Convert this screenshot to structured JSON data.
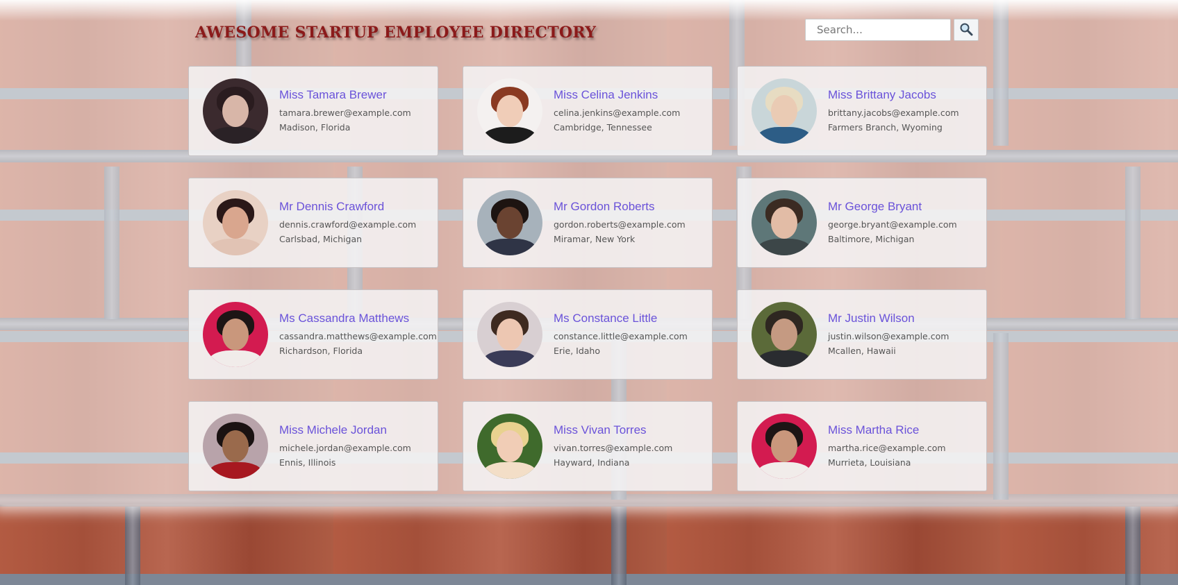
{
  "header": {
    "title": "AWESOME STARTUP EMPLOYEE DIRECTORY",
    "search_placeholder": "Search...",
    "search_icon": "magnifier-icon"
  },
  "employees": [
    {
      "name": "Miss Tamara Brewer",
      "email": "tamara.brewer@example.com",
      "location": "Madison, Florida",
      "avatar": {
        "bg": "#3b2a2e",
        "hair": "#2a1c1f",
        "face": "#d8b6a8",
        "body": "#2a2226"
      }
    },
    {
      "name": "Miss Celina Jenkins",
      "email": "celina.jenkins@example.com",
      "location": "Cambridge, Tennessee",
      "avatar": {
        "bg": "#f4f1f0",
        "hair": "#8a3a22",
        "face": "#f0cdb8",
        "body": "#1c1c1c"
      }
    },
    {
      "name": "Miss Brittany Jacobs",
      "email": "brittany.jacobs@example.com",
      "location": "Farmers Branch, Wyoming",
      "avatar": {
        "bg": "#c9d6d9",
        "hair": "#e7dcc2",
        "face": "#eacbb4",
        "body": "#2d5d86"
      }
    },
    {
      "name": "Mr Dennis Crawford",
      "email": "dennis.crawford@example.com",
      "location": "Carlsbad, Michigan",
      "avatar": {
        "bg": "#e8d1c4",
        "hair": "#2a1818",
        "face": "#d9a68e",
        "body": "#e1c3b4"
      }
    },
    {
      "name": "Mr Gordon Roberts",
      "email": "gordon.roberts@example.com",
      "location": "Miramar, New York",
      "avatar": {
        "bg": "#a7b2bb",
        "hair": "#1d1411",
        "face": "#6a4331",
        "body": "#2f3446"
      }
    },
    {
      "name": "Mr George Bryant",
      "email": "george.bryant@example.com",
      "location": "Baltimore, Michigan",
      "avatar": {
        "bg": "#5e7778",
        "hair": "#3b2b22",
        "face": "#e2bca6",
        "body": "#3c4648"
      }
    },
    {
      "name": "Ms Cassandra Matthews",
      "email": "cassandra.matthews@example.com",
      "location": "Richardson, Florida",
      "avatar": {
        "bg": "#d31b50",
        "hair": "#1d1515",
        "face": "#c9977c",
        "body": "#f1ecea"
      }
    },
    {
      "name": "Ms Constance Little",
      "email": "constance.little@example.com",
      "location": "Erie, Idaho",
      "avatar": {
        "bg": "#d8cfd2",
        "hair": "#3e2a20",
        "face": "#edc7b2",
        "body": "#3a3b57"
      }
    },
    {
      "name": "Mr Justin Wilson",
      "email": "justin.wilson@example.com",
      "location": "Mcallen, Hawaii",
      "avatar": {
        "bg": "#5b6a39",
        "hair": "#2e2721",
        "face": "#c59a82",
        "body": "#2a2c30"
      }
    },
    {
      "name": "Miss Michele Jordan",
      "email": "michele.jordan@example.com",
      "location": "Ennis, Illinois",
      "avatar": {
        "bg": "#b8a3aa",
        "hair": "#1a1212",
        "face": "#9a6a4c",
        "body": "#a71820"
      }
    },
    {
      "name": "Miss Vivan Torres",
      "email": "vivan.torres@example.com",
      "location": "Hayward, Indiana",
      "avatar": {
        "bg": "#3f6a2c",
        "hair": "#e8d28f",
        "face": "#f1cdb6",
        "body": "#f3dec7"
      }
    },
    {
      "name": "Miss Martha Rice",
      "email": "martha.rice@example.com",
      "location": "Murrieta, Louisiana",
      "avatar": {
        "bg": "#d31b50",
        "hair": "#1d1515",
        "face": "#c9977c",
        "body": "#f1ecea"
      }
    }
  ]
}
